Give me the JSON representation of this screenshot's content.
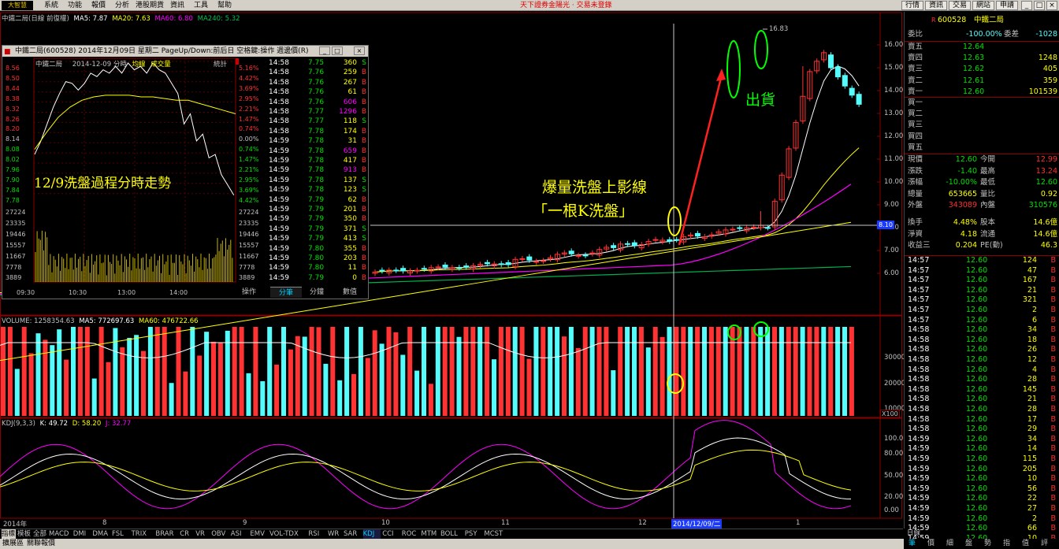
{
  "menubar": {
    "logo": "大智慧",
    "items": [
      "系統",
      "功能",
      "報價",
      "分析",
      "港股期貨",
      "資訊",
      "工具",
      "幫助"
    ],
    "marquee": "天下證券金陽光 · 交易未登錄",
    "right_buttons": [
      "行情",
      "資訊",
      "交易",
      "網站",
      "申請"
    ]
  },
  "chart": {
    "header": {
      "name": "中鐵二局(日線 前復權)",
      "ma5": "MA5: 7.87",
      "ma20": "MA20: 7.63",
      "ma60": "MA60: 6.80",
      "ma240": "MA240: 5.32"
    },
    "price_axis": [
      "16.00",
      "15.00",
      "14.00",
      "13.00",
      "12.00",
      "11.00",
      "10.00",
      "9.00",
      "8.00",
      "7.00",
      "6.00"
    ],
    "crosshair_price": "8.10",
    "high_label": "16.83",
    "annotation_main": "爆量洗盤上影線",
    "annotation_sub": "「一根K洗盤」",
    "annotation_out": "出貨",
    "colors": {
      "up": "#ff3333",
      "down": "#54fcfc",
      "ma5": "#ffffff",
      "ma20": "#ffff00",
      "ma60": "#ff00ff",
      "ma240": "#00b050"
    },
    "volume_header": {
      "label": "VOLUME: 1258354.63",
      "ma5": "MA5: 772697.63",
      "ma60": "MA60: 476722.66"
    },
    "volume_axis": [
      "30000",
      "20000",
      "10000"
    ],
    "volume_unit": "X100",
    "kdj_header": {
      "label": "KDJ(9,3,3)",
      "k": "K: 49.72",
      "d": "D: 58.20",
      "j": "J: 32.77"
    },
    "kdj_axis": [
      "100.00",
      "80.00",
      "50.00",
      "20.00",
      "0.00"
    ],
    "time_axis": [
      "2014年",
      "8",
      "9",
      "10",
      "11",
      "12",
      "2014/12/09/二",
      "1"
    ]
  },
  "popup": {
    "title": "中鐵二局(600528) 2014年12月09日 星期二 PageUp/Down:前后日 空格鍵:操作 週邊價(R)",
    "sub_name": "中鐵二局",
    "sub_date": "2014-12-09 分時",
    "sub_avg": "均線",
    "sub_vol": "成交量",
    "sub_stat": "統計",
    "overlay_text": "12/9洗盤過程分時走勢",
    "left_axis": [
      "8.56",
      "8.50",
      "8.44",
      "8.38",
      "8.32",
      "8.26",
      "8.20",
      "8.14",
      "8.08",
      "8.02",
      "7.96",
      "7.90",
      "7.84",
      "7.78",
      "27224",
      "23335",
      "19446",
      "15557",
      "11667",
      "7778",
      "3889"
    ],
    "right_axis": [
      "5.16%",
      "4.42%",
      "3.69%",
      "2.95%",
      "2.21%",
      "1.47%",
      "0.74%",
      "0.00%",
      "0.74%",
      "1.47%",
      "2.21%",
      "2.95%",
      "3.69%",
      "4.42%",
      "27224",
      "23335",
      "19446",
      "15557",
      "11667",
      "7778",
      "3889"
    ],
    "time_axis": [
      "09:30",
      "10:30",
      "13:00",
      "14:00"
    ],
    "ticks": [
      [
        "14:58",
        "7.75",
        "360",
        "S"
      ],
      [
        "14:58",
        "7.76",
        "259",
        "B"
      ],
      [
        "14:58",
        "7.76",
        "267",
        "B"
      ],
      [
        "14:58",
        "7.76",
        "61",
        "B"
      ],
      [
        "14:58",
        "7.76",
        "606",
        "B"
      ],
      [
        "14:58",
        "7.77",
        "1296",
        "B"
      ],
      [
        "14:58",
        "7.77",
        "118",
        "S"
      ],
      [
        "14:58",
        "7.78",
        "174",
        "B"
      ],
      [
        "14:59",
        "7.78",
        "31",
        "B"
      ],
      [
        "14:59",
        "7.78",
        "659",
        "B"
      ],
      [
        "14:59",
        "7.78",
        "417",
        "B"
      ],
      [
        "14:59",
        "7.78",
        "913",
        "B"
      ],
      [
        "14:59",
        "7.78",
        "137",
        "S"
      ],
      [
        "14:59",
        "7.78",
        "123",
        "S"
      ],
      [
        "14:59",
        "7.79",
        "62",
        "B"
      ],
      [
        "14:59",
        "7.79",
        "201",
        "B"
      ],
      [
        "14:59",
        "7.79",
        "350",
        "B"
      ],
      [
        "14:59",
        "7.79",
        "371",
        "S"
      ],
      [
        "14:59",
        "7.79",
        "413",
        "S"
      ],
      [
        "14:59",
        "7.80",
        "355",
        "B"
      ],
      [
        "14:59",
        "7.80",
        "203",
        "B"
      ],
      [
        "14:59",
        "7.80",
        "11",
        "B"
      ],
      [
        "14:59",
        "7.79",
        "0",
        "B"
      ]
    ],
    "tabs": [
      "操作",
      "分筆",
      "分鐘",
      "數值"
    ]
  },
  "rpanel": {
    "code": "600528",
    "name": "中鐵二局",
    "webi_label": "委比",
    "webi": "-100.00%",
    "weicha_label": "委差",
    "weicha": "-1028",
    "asks": [
      [
        "賣五",
        "12.64",
        ""
      ],
      [
        "賣四",
        "12.63",
        "1248"
      ],
      [
        "賣三",
        "12.62",
        "405"
      ],
      [
        "賣二",
        "12.61",
        "359"
      ],
      [
        "賣一",
        "12.60",
        "101539"
      ]
    ],
    "bids": [
      "買一",
      "買二",
      "買三",
      "買四",
      "買五"
    ],
    "stats": [
      [
        "現價",
        "12.60",
        "今開",
        "12.99"
      ],
      [
        "漲跌",
        "-1.40",
        "最高",
        "13.24"
      ],
      [
        "漲幅",
        "-10.00%",
        "最低",
        "12.60"
      ],
      [
        "總量",
        "653665",
        "量比",
        "0.92"
      ],
      [
        "外盤",
        "343089",
        "內盤",
        "310576"
      ],
      [
        "換手",
        "4.48%",
        "股本",
        "14.6億"
      ],
      [
        "淨資",
        "4.18",
        "流通",
        "14.6億"
      ],
      [
        "收益三",
        "0.204",
        "PE(動)",
        "46.3"
      ]
    ],
    "ticks": [
      [
        "14:57",
        "12.60",
        "124",
        "B"
      ],
      [
        "14:57",
        "12.60",
        "47",
        "B"
      ],
      [
        "14:57",
        "12.60",
        "167",
        "B"
      ],
      [
        "14:57",
        "12.60",
        "21",
        "B"
      ],
      [
        "14:57",
        "12.60",
        "321",
        "B"
      ],
      [
        "14:57",
        "12.60",
        "2",
        "B"
      ],
      [
        "14:57",
        "12.60",
        "6",
        "B"
      ],
      [
        "14:58",
        "12.60",
        "34",
        "B"
      ],
      [
        "14:58",
        "12.60",
        "18",
        "B"
      ],
      [
        "14:58",
        "12.60",
        "26",
        "B"
      ],
      [
        "14:58",
        "12.60",
        "12",
        "B"
      ],
      [
        "14:58",
        "12.60",
        "4",
        "B"
      ],
      [
        "14:58",
        "12.60",
        "28",
        "B"
      ],
      [
        "14:58",
        "12.60",
        "145",
        "B"
      ],
      [
        "14:58",
        "12.60",
        "21",
        "B"
      ],
      [
        "14:58",
        "12.60",
        "28",
        "B"
      ],
      [
        "14:58",
        "12.60",
        "17",
        "B"
      ],
      [
        "14:58",
        "12.60",
        "29",
        "B"
      ],
      [
        "14:59",
        "12.60",
        "34",
        "B"
      ],
      [
        "14:59",
        "12.60",
        "14",
        "B"
      ],
      [
        "14:59",
        "12.60",
        "115",
        "B"
      ],
      [
        "14:59",
        "12.60",
        "205",
        "B"
      ],
      [
        "14:59",
        "12.60",
        "10",
        "B"
      ],
      [
        "14:59",
        "12.60",
        "56",
        "B"
      ],
      [
        "14:59",
        "12.60",
        "22",
        "B"
      ],
      [
        "14:59",
        "12.60",
        "27",
        "B"
      ],
      [
        "14:59",
        "12.60",
        "2",
        "B"
      ],
      [
        "14:59",
        "12.60",
        "66",
        "B"
      ],
      [
        "14:59",
        "12.60",
        "10",
        "B"
      ]
    ],
    "bottom_label": "日線",
    "bottom_tabs": [
      "筆",
      "價",
      "細",
      "盤",
      "勢",
      "指",
      "值",
      "評"
    ]
  },
  "bottom_tabs": [
    "指標",
    "模板",
    "全部",
    "MACD",
    "DMI",
    "DMA",
    "FSL",
    "TRIX",
    "BRAR",
    "CR",
    "VR",
    "OBV",
    "ASI",
    "EMV",
    "VOL-TDX",
    "RSI",
    "WR",
    "SAR",
    "KDJ",
    "CCI",
    "ROC",
    "MTM",
    "BOLL",
    "PSY",
    "MCST"
  ],
  "status": {
    "a": "擴展區",
    "b": "關聯報價"
  }
}
